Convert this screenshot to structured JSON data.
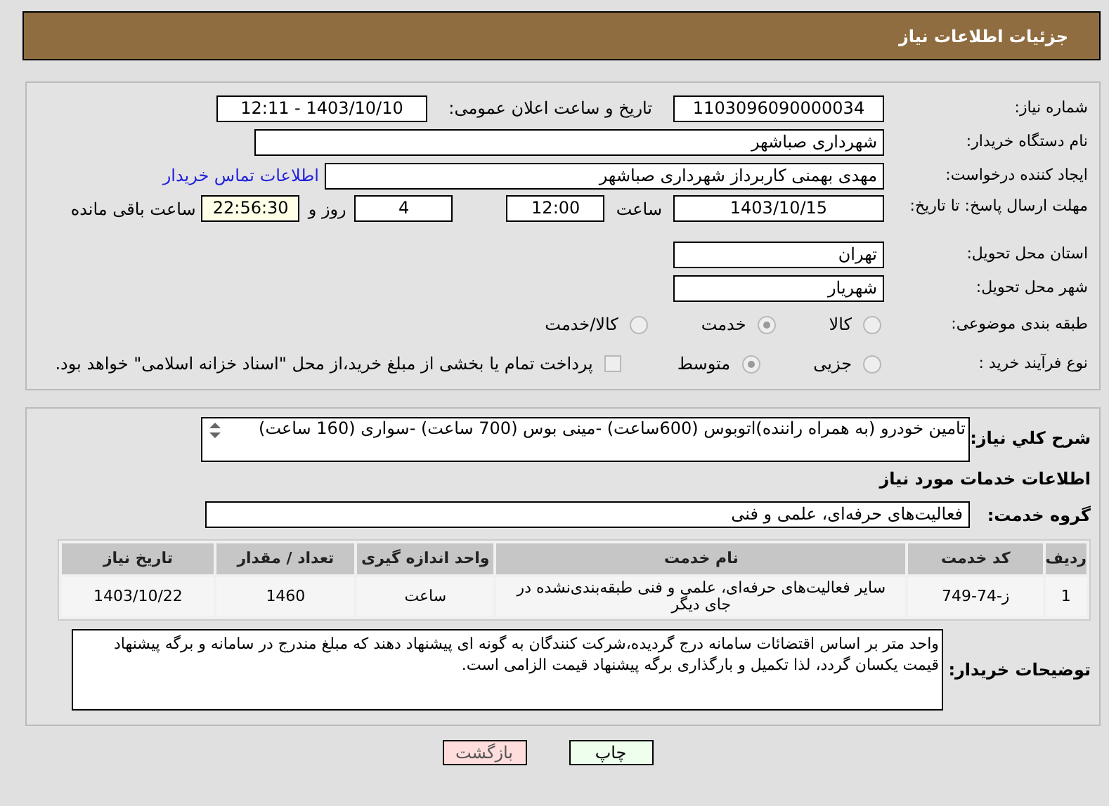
{
  "header": {
    "title": "جزئیات اطلاعات نیاز"
  },
  "details": {
    "need_number": {
      "label": "شماره نیاز:",
      "value": "1103096090000034"
    },
    "announce": {
      "label": "تاریخ و ساعت اعلان عمومی:",
      "value": "1403/10/10 - 12:11"
    },
    "buyer": {
      "label": "نام دستگاه خریدار:",
      "value": "شهرداری صباشهر"
    },
    "creator": {
      "label": "ایجاد کننده درخواست:",
      "value": "مهدی بهمنی کاربرداز شهرداری صباشهر",
      "link": "اطلاعات تماس خریدار"
    },
    "deadline": {
      "label": "مهلت ارسال پاسخ: تا تاریخ:",
      "date": "1403/10/15",
      "time_label": "ساعت",
      "time": "12:00",
      "days": "4",
      "days_label": "روز و",
      "remaining": "22:56:30",
      "remaining_label": "ساعت باقی مانده"
    },
    "province": {
      "label": "استان محل تحویل:",
      "value": "تهران"
    },
    "city": {
      "label": "شهر محل تحویل:",
      "value": "شهریار"
    },
    "category": {
      "label": "طبقه بندی موضوعی:",
      "options": [
        {
          "label": "کالا",
          "selected": false
        },
        {
          "label": "خدمت",
          "selected": true
        },
        {
          "label": "کالا/خدمت",
          "selected": false
        }
      ]
    },
    "process": {
      "label": "نوع فرآیند خرید :",
      "options": [
        {
          "label": "جزیی",
          "selected": false
        },
        {
          "label": "متوسط",
          "selected": true
        }
      ],
      "treasury": {
        "label": "پرداخت تمام یا بخشی از مبلغ خرید،از محل \"اسناد خزانه اسلامی\" خواهد بود.",
        "checked": false
      }
    }
  },
  "summary": {
    "label": "شرح کلي نیاز:",
    "value": "تامین خودرو (به همراه راننده)اتوبوس  (600ساعت)     -مینی بوس (700 ساعت)      -سواری  (160 ساعت)"
  },
  "services": {
    "title": "اطلاعات خدمات مورد نیاز",
    "group_label": "گروه خدمت:",
    "group": "فعالیت‌های حرفه‌ای، علمی و فنی",
    "table": {
      "columns": [
        "ردیف",
        "کد خدمت",
        "نام خدمت",
        "واحد اندازه گیری",
        "تعداد / مقدار",
        "تاریخ نیاز"
      ],
      "rows": [
        [
          "1",
          "ز-74-749",
          "سایر فعالیت‌های حرفه‌ای، علمی و فنی طبقه‌بندی‌نشده در جای دیگر",
          "ساعت",
          "1460",
          "1403/10/22"
        ]
      ]
    }
  },
  "notes": {
    "label": "توضیحات خریدار:",
    "value": "واحد متر بر اساس اقتضائات سامانه درج گردیده،شرکت کنندگان به گونه ای پیشنهاد دهند که مبلغ مندرج در سامانه و برگه پیشنهاد قیمت یکسان گردد، لذا تکمیل و بارگذاری برگه پیشنهاد قیمت الزامی است."
  },
  "buttons": [
    {
      "label": "چاپ",
      "kind": "print"
    },
    {
      "label": "بازگشت",
      "kind": "back"
    }
  ]
}
